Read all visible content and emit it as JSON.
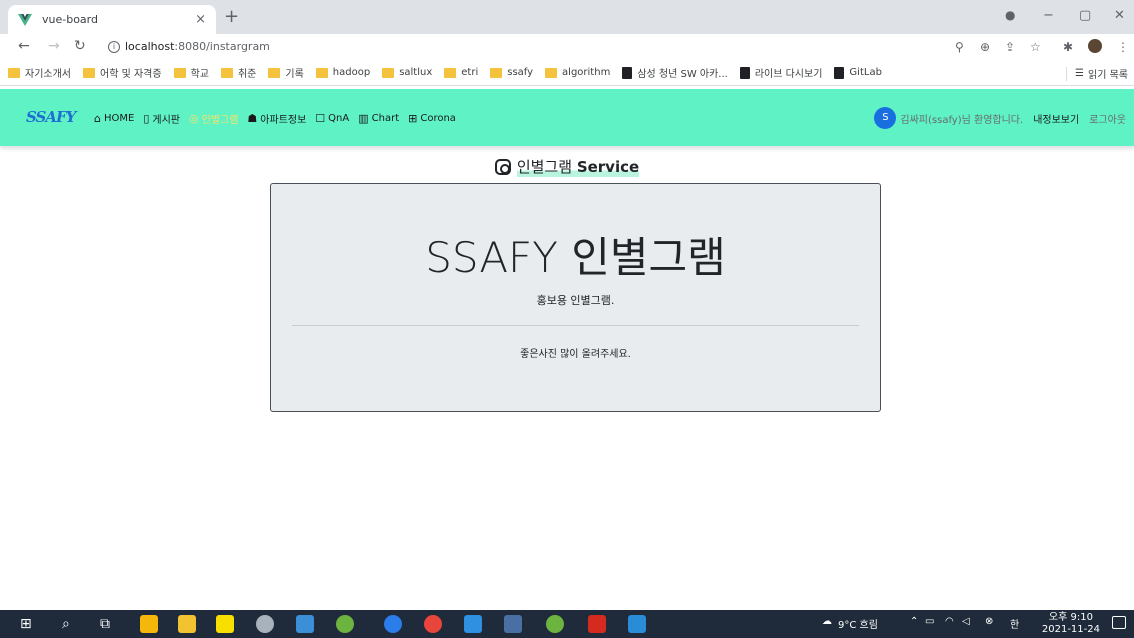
{
  "browser": {
    "tab_title": "vue-board",
    "tab_close": "×",
    "new_tab": "+",
    "url_host": "localhost",
    "url_path": ":8080/instargram",
    "window_controls": [
      "−",
      "▢",
      "✕"
    ],
    "bookmarks": [
      {
        "label": "자기소개서",
        "icon": "folder-icon"
      },
      {
        "label": "어학 및 자격증",
        "icon": "folder-icon"
      },
      {
        "label": "학교",
        "icon": "folder-icon"
      },
      {
        "label": "취준",
        "icon": "folder-icon"
      },
      {
        "label": "기록",
        "icon": "folder-icon"
      },
      {
        "label": "hadoop",
        "icon": "folder-icon"
      },
      {
        "label": "saltlux",
        "icon": "folder-icon"
      },
      {
        "label": "etri",
        "icon": "folder-icon"
      },
      {
        "label": "ssafy",
        "icon": "folder-icon"
      },
      {
        "label": "algorithm",
        "icon": "folder-icon"
      },
      {
        "label": "삼성 청년 SW 아카...",
        "icon": "gitlab-icon"
      },
      {
        "label": "라이브 다시보기",
        "icon": "gitlab-icon"
      },
      {
        "label": "GitLab",
        "icon": "gitlab-icon"
      }
    ],
    "reading_list": "읽기 목록"
  },
  "navbar": {
    "brand": "SSAFY",
    "items": [
      {
        "label": "HOME",
        "icon": "home-icon",
        "active": false
      },
      {
        "label": "게시판",
        "icon": "board-icon",
        "active": false
      },
      {
        "label": "인별그램",
        "icon": "instagram-icon",
        "active": true
      },
      {
        "label": "아파트정보",
        "icon": "house-icon",
        "active": false
      },
      {
        "label": "QnA",
        "icon": "chat-icon",
        "active": false
      },
      {
        "label": "Chart",
        "icon": "chart-icon",
        "active": false
      },
      {
        "label": "Corona",
        "icon": "plus-box-icon",
        "active": false
      }
    ],
    "avatar_initial": "S",
    "welcome": "김싸피(ssafy)님 환영합니다.",
    "mypage": "내정보보기",
    "logout": "로그아웃"
  },
  "page": {
    "heading_prefix": "인별그램",
    "heading_service": "Service"
  },
  "jumbotron": {
    "title": "SSAFY 인별그램",
    "lead": "홍보용 인별그램.",
    "message": "좋은사진 많이 올려주세요."
  },
  "taskbar": {
    "weather": "9°C 흐림",
    "ime": "한",
    "time": "오후 9:10",
    "date": "2021-11-24"
  },
  "colors": {
    "navbar_bg": "#5ef2c4",
    "active_nav": "#f7e36a",
    "jumbotron_bg": "#e9ecef",
    "brand": "#1f6ed4"
  }
}
